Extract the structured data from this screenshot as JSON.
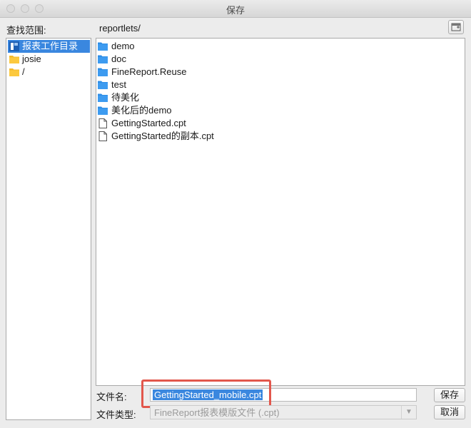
{
  "window": {
    "title": "保存"
  },
  "lookin": {
    "label": "查找范围:",
    "current_path": "reportlets/"
  },
  "sidebar": {
    "items": [
      {
        "label": "报表工作目录",
        "icon": "report-workspace-icon",
        "selected": true
      },
      {
        "label": "josie",
        "icon": "folder-icon",
        "selected": false
      },
      {
        "label": "/",
        "icon": "folder-icon",
        "selected": false
      }
    ]
  },
  "files": [
    {
      "name": "demo",
      "type": "folder"
    },
    {
      "name": "doc",
      "type": "folder"
    },
    {
      "name": "FineReport.Reuse",
      "type": "folder"
    },
    {
      "name": "test",
      "type": "folder"
    },
    {
      "name": "待美化",
      "type": "folder"
    },
    {
      "name": "美化后的demo",
      "type": "folder"
    },
    {
      "name": "GettingStarted.cpt",
      "type": "file"
    },
    {
      "name": "GettingStarted的副本.cpt",
      "type": "file"
    }
  ],
  "footer": {
    "filename_label": "文件名:",
    "filename_value": "GettingStarted_mobile.cpt",
    "filetype_label": "文件类型:",
    "filetype_value": "FineReport报表模版文件 (.cpt)",
    "save_label": "保存",
    "cancel_label": "取消"
  },
  "colors": {
    "selection": "#3a87df",
    "folder_blue": "#2f8ee6",
    "folder_yellow": "#f5b92a",
    "highlight_box": "#e2574c"
  }
}
